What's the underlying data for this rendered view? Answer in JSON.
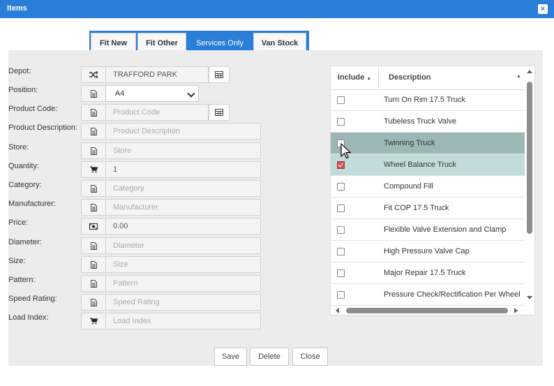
{
  "window": {
    "title": "Items",
    "close_glyph": "×"
  },
  "tabs": [
    {
      "label": "Fit New",
      "active": false
    },
    {
      "label": "Fit Other",
      "active": false
    },
    {
      "label": "Services Only",
      "active": true
    },
    {
      "label": "Van Stock",
      "active": false
    }
  ],
  "form": {
    "depot": {
      "label": "Depot:",
      "value": "TRAFFORD PARK",
      "icon": "shuffle-icon"
    },
    "position": {
      "label": "Position:",
      "value": "A4",
      "icon": "document-icon"
    },
    "product_code": {
      "label": "Product Code:",
      "placeholder": "Product Code",
      "icon": "document-icon"
    },
    "product_description": {
      "label": "Product Description:",
      "placeholder": "Product Description",
      "icon": "document-icon"
    },
    "store": {
      "label": "Store:",
      "placeholder": "Store",
      "icon": "document-icon"
    },
    "quantity": {
      "label": "Quantity:",
      "value": "1",
      "icon": "cart-icon"
    },
    "category": {
      "label": "Category:",
      "placeholder": "Category",
      "icon": "document-icon"
    },
    "manufacturer": {
      "label": "Manufacturer:",
      "placeholder": "Manufacturer",
      "icon": "document-icon"
    },
    "price": {
      "label": "Price:",
      "value": "0.00",
      "icon": "money-icon"
    },
    "diameter": {
      "label": "Diameter:",
      "placeholder": "Diameter",
      "icon": "document-icon"
    },
    "size": {
      "label": "Size:",
      "placeholder": "Size",
      "icon": "document-icon"
    },
    "pattern": {
      "label": "Pattern:",
      "placeholder": "Pattern",
      "icon": "document-icon"
    },
    "speed_rating": {
      "label": "Speed Rating:",
      "placeholder": "Speed Rating",
      "icon": "document-icon"
    },
    "load_index": {
      "label": "Load Index:",
      "placeholder": "Load Index",
      "icon": "cart-icon"
    }
  },
  "grid": {
    "columns": {
      "include": "Include",
      "description": "Description"
    },
    "rows": [
      {
        "description": "Turn On Rim 17.5 Truck",
        "checked": false,
        "state": ""
      },
      {
        "description": "Tubeless Truck Valve",
        "checked": false,
        "state": ""
      },
      {
        "description": "Twinning Truck",
        "checked": false,
        "state": "hover"
      },
      {
        "description": "Wheel Balance Truck",
        "checked": true,
        "state": "selected"
      },
      {
        "description": "Compound Fill",
        "checked": false,
        "state": ""
      },
      {
        "description": "Fit COP 17.5 Truck",
        "checked": false,
        "state": ""
      },
      {
        "description": "Flexible Valve Extension and Clamp",
        "checked": false,
        "state": ""
      },
      {
        "description": "High Pressure Valve Cap",
        "checked": false,
        "state": ""
      },
      {
        "description": "Major Repair 17.5 Truck",
        "checked": false,
        "state": ""
      },
      {
        "description": "Pressure Check/Rectification Per Wheel",
        "checked": false,
        "state": ""
      }
    ]
  },
  "footer": {
    "save": "Save",
    "delete": "Delete",
    "close": "Close"
  },
  "colors": {
    "accent": "#2a7ed8",
    "row_hover": "#9bb8b6",
    "row_selected": "#c3dcdb"
  }
}
